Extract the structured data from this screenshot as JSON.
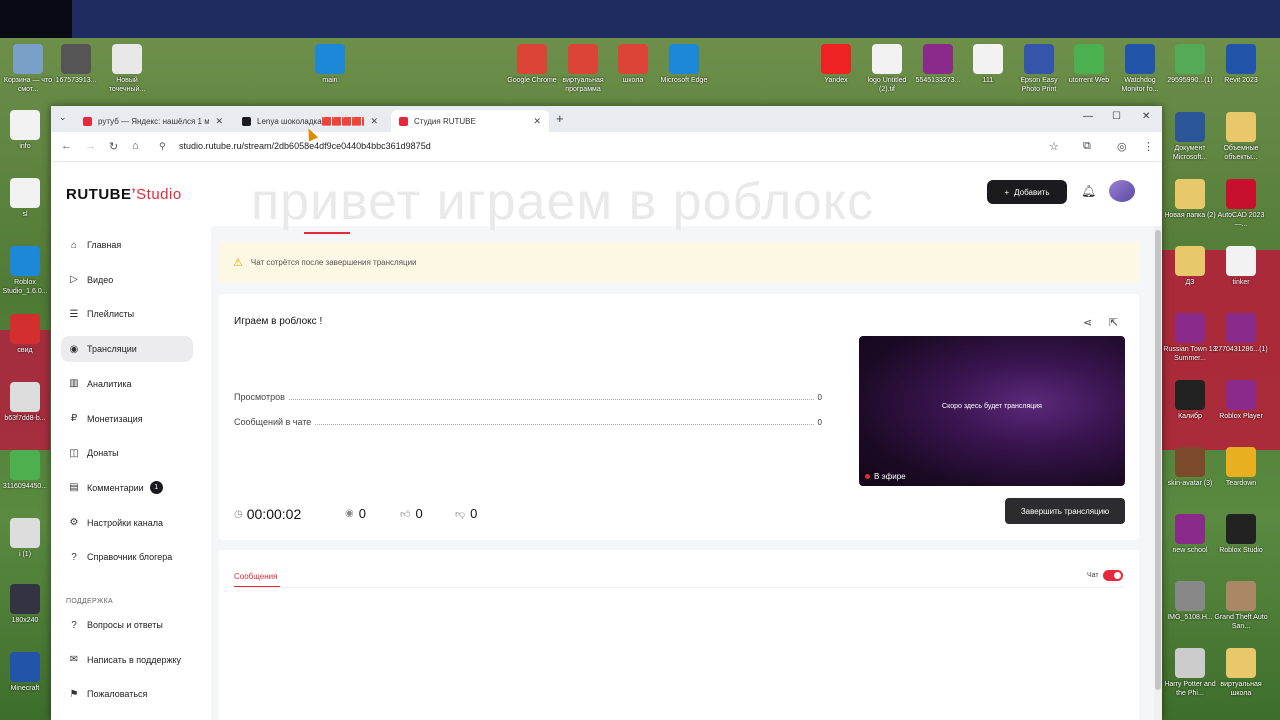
{
  "desktop": {
    "top_icons": [
      {
        "label": "Корзина — что смот...",
        "color": "#7aa0c8"
      },
      {
        "label": "167573913...",
        "color": "#555"
      },
      {
        "label": "Новый точечный...",
        "color": "#e8e8e8"
      },
      {
        "label": "main",
        "color": "#1e88d8"
      },
      {
        "label": "Google Chrome",
        "color": "#db4437"
      },
      {
        "label": "виртуальная программа",
        "color": "#db4437"
      },
      {
        "label": "школа",
        "color": "#db4437"
      },
      {
        "label": "Microsoft Edge",
        "color": "#1e88d8"
      },
      {
        "label": "Yandex",
        "color": "#e22"
      },
      {
        "label": "logo Untitled (2).tif",
        "color": "#f2f2f2"
      },
      {
        "label": "5545133273...",
        "color": "#8a2a8a"
      },
      {
        "label": "111",
        "color": "#f2f2f2"
      },
      {
        "label": "Epson Easy Photo Print",
        "color": "#3355aa"
      },
      {
        "label": "utorrent Web",
        "color": "#4caf50"
      },
      {
        "label": "Watchdog Monitor fo...",
        "color": "#2255aa"
      },
      {
        "label": "29595990...(1)",
        "color": "#55aa55"
      },
      {
        "label": "Revit 2023",
        "color": "#2255aa"
      }
    ],
    "left_icons": [
      {
        "label": "info",
        "color": "#f2f2f2"
      },
      {
        "label": "sl",
        "color": "#f2f2f2"
      },
      {
        "label": "Roblox Studio_1.6.0...",
        "color": "#1e88d8"
      },
      {
        "label": "свид",
        "color": "#d32f2f"
      },
      {
        "label": "b63f7dd8-b...",
        "color": "#ddd"
      },
      {
        "label": "3116094450...",
        "color": "#4caf50"
      },
      {
        "label": "i (1)",
        "color": "#ddd"
      },
      {
        "label": "180x240",
        "color": "#334"
      },
      {
        "label": "Minecraft",
        "color": "#2255aa"
      }
    ],
    "right_icons": [
      {
        "label": "Документ Microsoft...",
        "color": "#2b579a"
      },
      {
        "label": "Объемные объекты...",
        "color": "#e8c86a"
      },
      {
        "label": "Новая папка (2)",
        "color": "#e8c86a"
      },
      {
        "label": "AutoCAD 2023 —...",
        "color": "#c8102e"
      },
      {
        "label": "ДЗ",
        "color": "#e8c86a"
      },
      {
        "label": "tinker",
        "color": "#f2f2f2"
      },
      {
        "label": "Russian Town 13 Summer...",
        "color": "#8a2a8a"
      },
      {
        "label": "2770431286...(1)",
        "color": "#8a2a8a"
      },
      {
        "label": "Калибр",
        "color": "#222"
      },
      {
        "label": "Roblox Player",
        "color": "#8a2a8a"
      },
      {
        "label": "skin-avatar (3)",
        "color": "#7a4a2a"
      },
      {
        "label": "Teardown",
        "color": "#e8b020"
      },
      {
        "label": "new school",
        "color": "#8a2a8a"
      },
      {
        "label": "Roblox Studio",
        "color": "#222"
      },
      {
        "label": "IMG_5108.H...",
        "color": "#888"
      },
      {
        "label": "Grand Theft Auto San...",
        "color": "#a86"
      },
      {
        "label": "Harry Potter and the Phi...",
        "color": "#ccc"
      },
      {
        "label": "виртуальная школа",
        "color": "#e8c86a"
      }
    ]
  },
  "browser": {
    "tabs": [
      {
        "title": "рутуб — Яндекс: нашёлся 1 м...",
        "favicon_color": "#e6283c"
      },
      {
        "title": "Lenya шоколадка🟥🟥🟥🟥🟥🙂",
        "favicon_color": "#1b1b1f"
      },
      {
        "title": "Студия RUTUBE",
        "favicon_color": "#e6283c"
      }
    ],
    "url": "studio.rutube.ru/stream/2db6058e4df9ce0440b4bbc361d9875d"
  },
  "page": {
    "logo_main": "RUTUBE",
    "logo_sub": "Studio",
    "overlay_title": "привет играем в роблокс",
    "add_button": "Добавить",
    "sidebar": {
      "items": [
        {
          "label": "Главная",
          "icon": "home-icon",
          "glyph": "⌂"
        },
        {
          "label": "Видео",
          "icon": "video-icon",
          "glyph": "▷"
        },
        {
          "label": "Плейлисты",
          "icon": "playlist-icon",
          "glyph": "☰"
        },
        {
          "label": "Трансляции",
          "icon": "broadcast-icon",
          "glyph": "◉"
        },
        {
          "label": "Аналитика",
          "icon": "analytics-icon",
          "glyph": "▥"
        },
        {
          "label": "Монетизация",
          "icon": "monetization-icon",
          "glyph": "₽"
        },
        {
          "label": "Донаты",
          "icon": "donate-icon",
          "glyph": "◫"
        },
        {
          "label": "Комментарии",
          "icon": "comments-icon",
          "glyph": "▤",
          "badge": "1"
        },
        {
          "label": "Настройки канала",
          "icon": "settings-icon",
          "glyph": "⚙"
        },
        {
          "label": "Справочник блогера",
          "icon": "help-icon",
          "glyph": "?"
        }
      ],
      "support_heading": "ПОДДЕРЖКА",
      "support_items": [
        {
          "label": "Вопросы и ответы",
          "icon": "faq-icon",
          "glyph": "?"
        },
        {
          "label": "Написать в поддержку",
          "icon": "mail-icon",
          "glyph": "✉"
        },
        {
          "label": "Пожаловаться",
          "icon": "flag-icon",
          "glyph": "⚑"
        }
      ]
    },
    "warning": "Чат сотрётся после завершения трансляции",
    "stream": {
      "title": "Играем в роблокс !",
      "views_label": "Просмотров",
      "views_value": "0",
      "messages_label": "Сообщений в чате",
      "messages_value": "0",
      "preview_message": "Скоро здесь будет трансляция",
      "live_label": "В эфире",
      "timer": "00:00:02",
      "viewers": "0",
      "likes": "0",
      "dislikes": "0",
      "end_button": "Завершить трансляцию"
    },
    "chat": {
      "tab": "Сообщения",
      "toggle_label": "Чат"
    }
  }
}
